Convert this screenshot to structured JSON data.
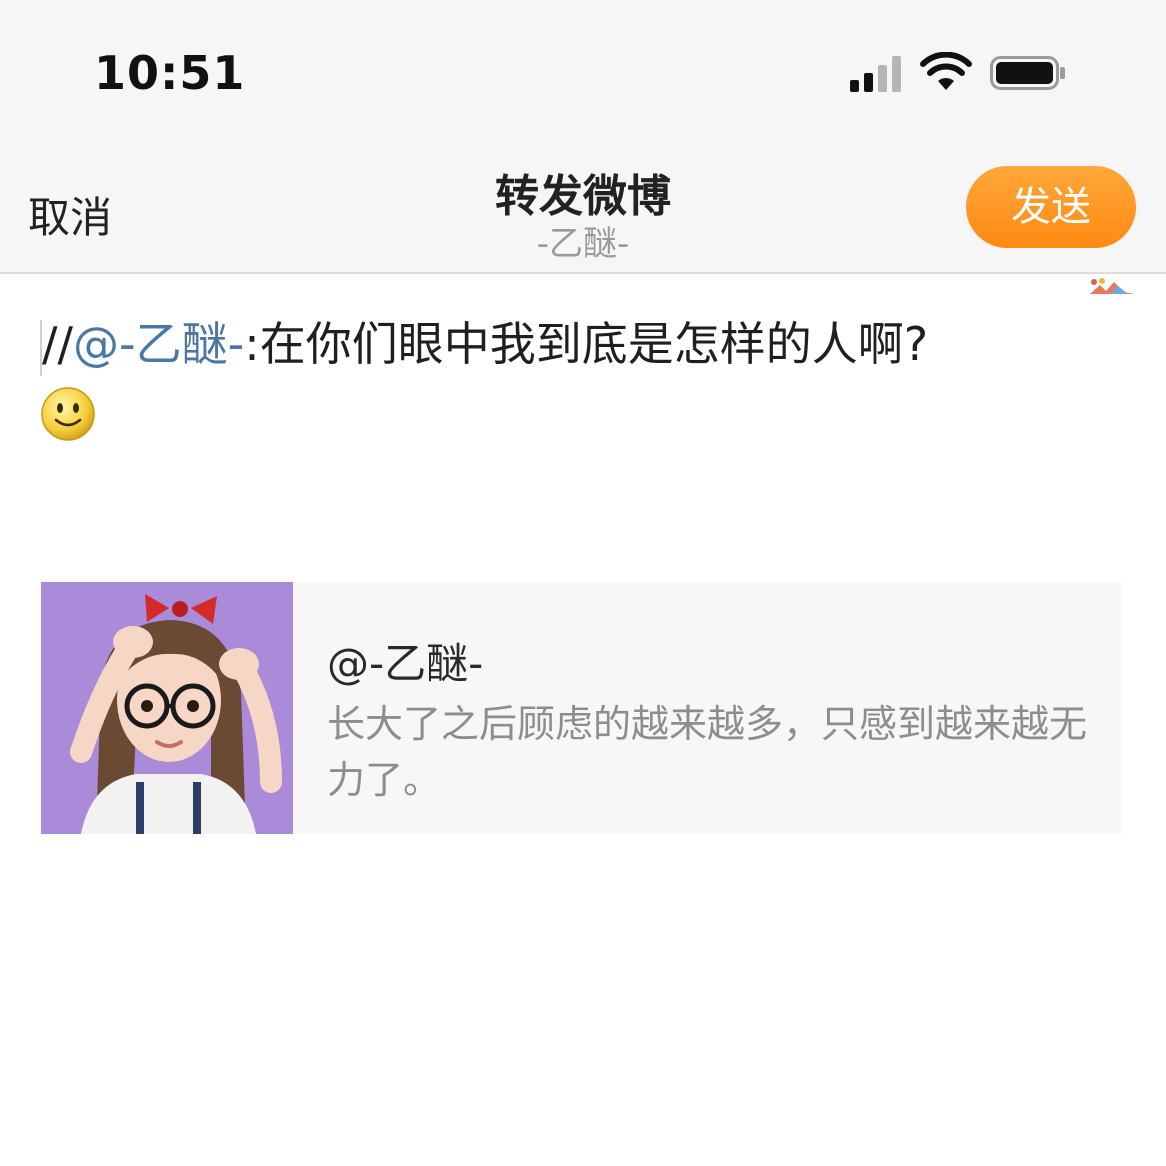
{
  "status_bar": {
    "time": "10:51",
    "icons": [
      "signal-icon",
      "wifi-icon",
      "battery-icon"
    ]
  },
  "header": {
    "cancel_label": "取消",
    "title": "转发微博",
    "subtitle": "-乙醚-",
    "send_label": "发送"
  },
  "compose": {
    "prefix": "//",
    "mention": "@-乙醚-",
    "text": ":在你们眼中我到底是怎样的人啊?",
    "emoji": "smiley-icon"
  },
  "quoted_post": {
    "author": "@-乙醚-",
    "text": "长大了之后顾虑的越来越多，只感到越来越无力了。"
  },
  "colors": {
    "accent": "#ff8a12",
    "mention": "#4b77a6",
    "header_bg": "#f6f6f6",
    "card_bg": "#f7f7f7",
    "muted_text": "#8d8d8d"
  }
}
